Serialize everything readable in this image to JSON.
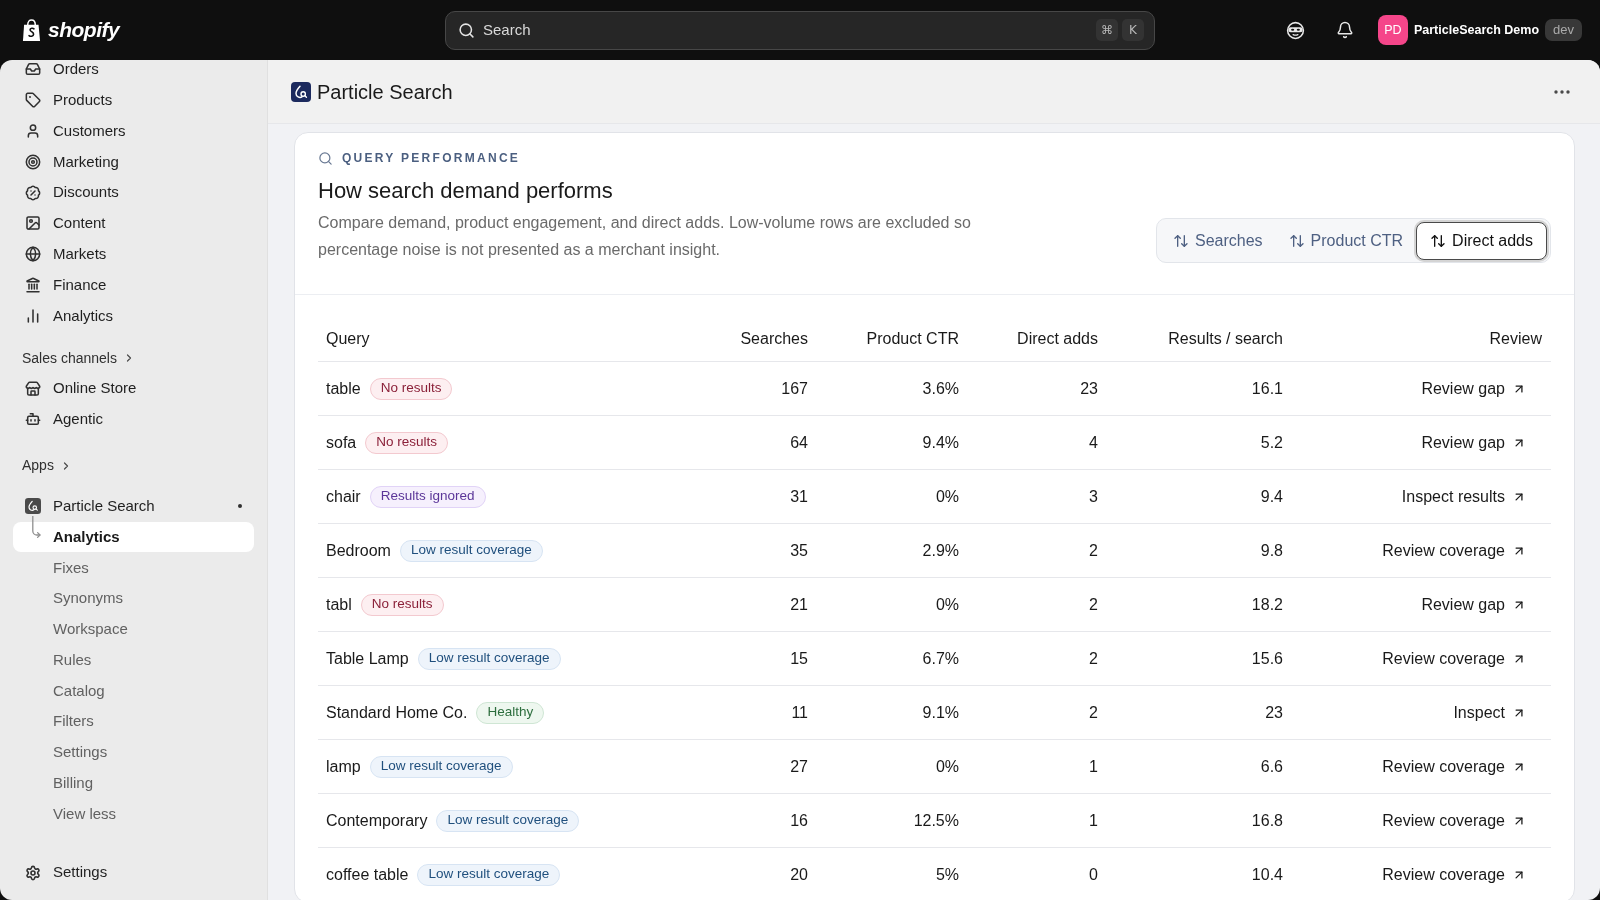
{
  "top_bar": {
    "logo_text": "shopify",
    "search": {
      "placeholder": "Search",
      "shortcut_keys": [
        "⌘",
        "K"
      ]
    },
    "account": {
      "initials": "PD",
      "name": "ParticleSearch Demo",
      "tag": "dev"
    }
  },
  "sidebar": {
    "items": [
      {
        "label": "Orders",
        "selected": false
      },
      {
        "label": "Products",
        "selected": false
      },
      {
        "label": "Customers",
        "selected": false
      },
      {
        "label": "Marketing",
        "selected": false
      },
      {
        "label": "Discounts",
        "selected": false
      },
      {
        "label": "Content",
        "selected": false
      },
      {
        "label": "Markets",
        "selected": false
      },
      {
        "label": "Finance",
        "selected": false
      },
      {
        "label": "Analytics",
        "selected": false
      }
    ],
    "sections": [
      {
        "title": "Sales channels",
        "items": [
          {
            "label": "Online Store",
            "selected": false
          },
          {
            "label": "Agentic",
            "selected": false
          }
        ]
      },
      {
        "title": "Apps",
        "items": [
          {
            "label": "Particle Search",
            "selected": false,
            "children": [
              {
                "label": "Analytics",
                "selected": true
              },
              {
                "label": "Fixes",
                "selected": false
              },
              {
                "label": "Synonyms",
                "selected": false
              },
              {
                "label": "Workspace",
                "selected": false
              },
              {
                "label": "Rules",
                "selected": false
              },
              {
                "label": "Catalog",
                "selected": false
              },
              {
                "label": "Filters",
                "selected": false
              },
              {
                "label": "Settings",
                "selected": false
              },
              {
                "label": "Billing",
                "selected": false
              }
            ],
            "toggle_label": "View less"
          }
        ]
      }
    ],
    "footer_item": {
      "label": "Settings",
      "selected": false
    }
  },
  "page_header": {
    "title": "Particle Search"
  },
  "card": {
    "eyebrow": "QUERY PERFORMANCE",
    "heading": "How search demand performs",
    "description": "Compare demand, product engagement, and direct adds. Low-volume rows are excluded so percentage noise is not presented as a merchant insight.",
    "sort_options": [
      {
        "label": "Searches",
        "selected": false
      },
      {
        "label": "Product CTR",
        "selected": false
      },
      {
        "label": "Direct adds",
        "selected": true
      }
    ],
    "table": {
      "columns": [
        "Query",
        "Searches",
        "Product CTR",
        "Direct adds",
        "Results / search",
        "Review"
      ],
      "rows": [
        {
          "query": "table",
          "status": {
            "label": "No results",
            "kind": "critical"
          },
          "searches": "167",
          "product_ctr": "3.6%",
          "direct_adds": "23",
          "results_per_search": "16.1",
          "review": "Review gap"
        },
        {
          "query": "sofa",
          "status": {
            "label": "No results",
            "kind": "critical"
          },
          "searches": "64",
          "product_ctr": "9.4%",
          "direct_adds": "4",
          "results_per_search": "5.2",
          "review": "Review gap"
        },
        {
          "query": "chair",
          "status": {
            "label": "Results ignored",
            "kind": "magic"
          },
          "searches": "31",
          "product_ctr": "0%",
          "direct_adds": "3",
          "results_per_search": "9.4",
          "review": "Inspect results"
        },
        {
          "query": "Bedroom",
          "status": {
            "label": "Low result coverage",
            "kind": "info"
          },
          "searches": "35",
          "product_ctr": "2.9%",
          "direct_adds": "2",
          "results_per_search": "9.8",
          "review": "Review coverage"
        },
        {
          "query": "tabl",
          "status": {
            "label": "No results",
            "kind": "critical"
          },
          "searches": "21",
          "product_ctr": "0%",
          "direct_adds": "2",
          "results_per_search": "18.2",
          "review": "Review gap"
        },
        {
          "query": "Table Lamp",
          "status": {
            "label": "Low result coverage",
            "kind": "info"
          },
          "searches": "15",
          "product_ctr": "6.7%",
          "direct_adds": "2",
          "results_per_search": "15.6",
          "review": "Review coverage"
        },
        {
          "query": "Standard Home Co.",
          "status": {
            "label": "Healthy",
            "kind": "success"
          },
          "searches": "11",
          "product_ctr": "9.1%",
          "direct_adds": "2",
          "results_per_search": "23",
          "review": "Inspect"
        },
        {
          "query": "lamp",
          "status": {
            "label": "Low result coverage",
            "kind": "info"
          },
          "searches": "27",
          "product_ctr": "0%",
          "direct_adds": "1",
          "results_per_search": "6.6",
          "review": "Review coverage"
        },
        {
          "query": "Contemporary",
          "status": {
            "label": "Low result coverage",
            "kind": "info"
          },
          "searches": "16",
          "product_ctr": "12.5%",
          "direct_adds": "1",
          "results_per_search": "16.8",
          "review": "Review coverage"
        },
        {
          "query": "coffee table",
          "status": {
            "label": "Low result coverage",
            "kind": "info"
          },
          "searches": "20",
          "product_ctr": "5%",
          "direct_adds": "0",
          "results_per_search": "10.4",
          "review": "Review coverage"
        }
      ]
    }
  }
}
